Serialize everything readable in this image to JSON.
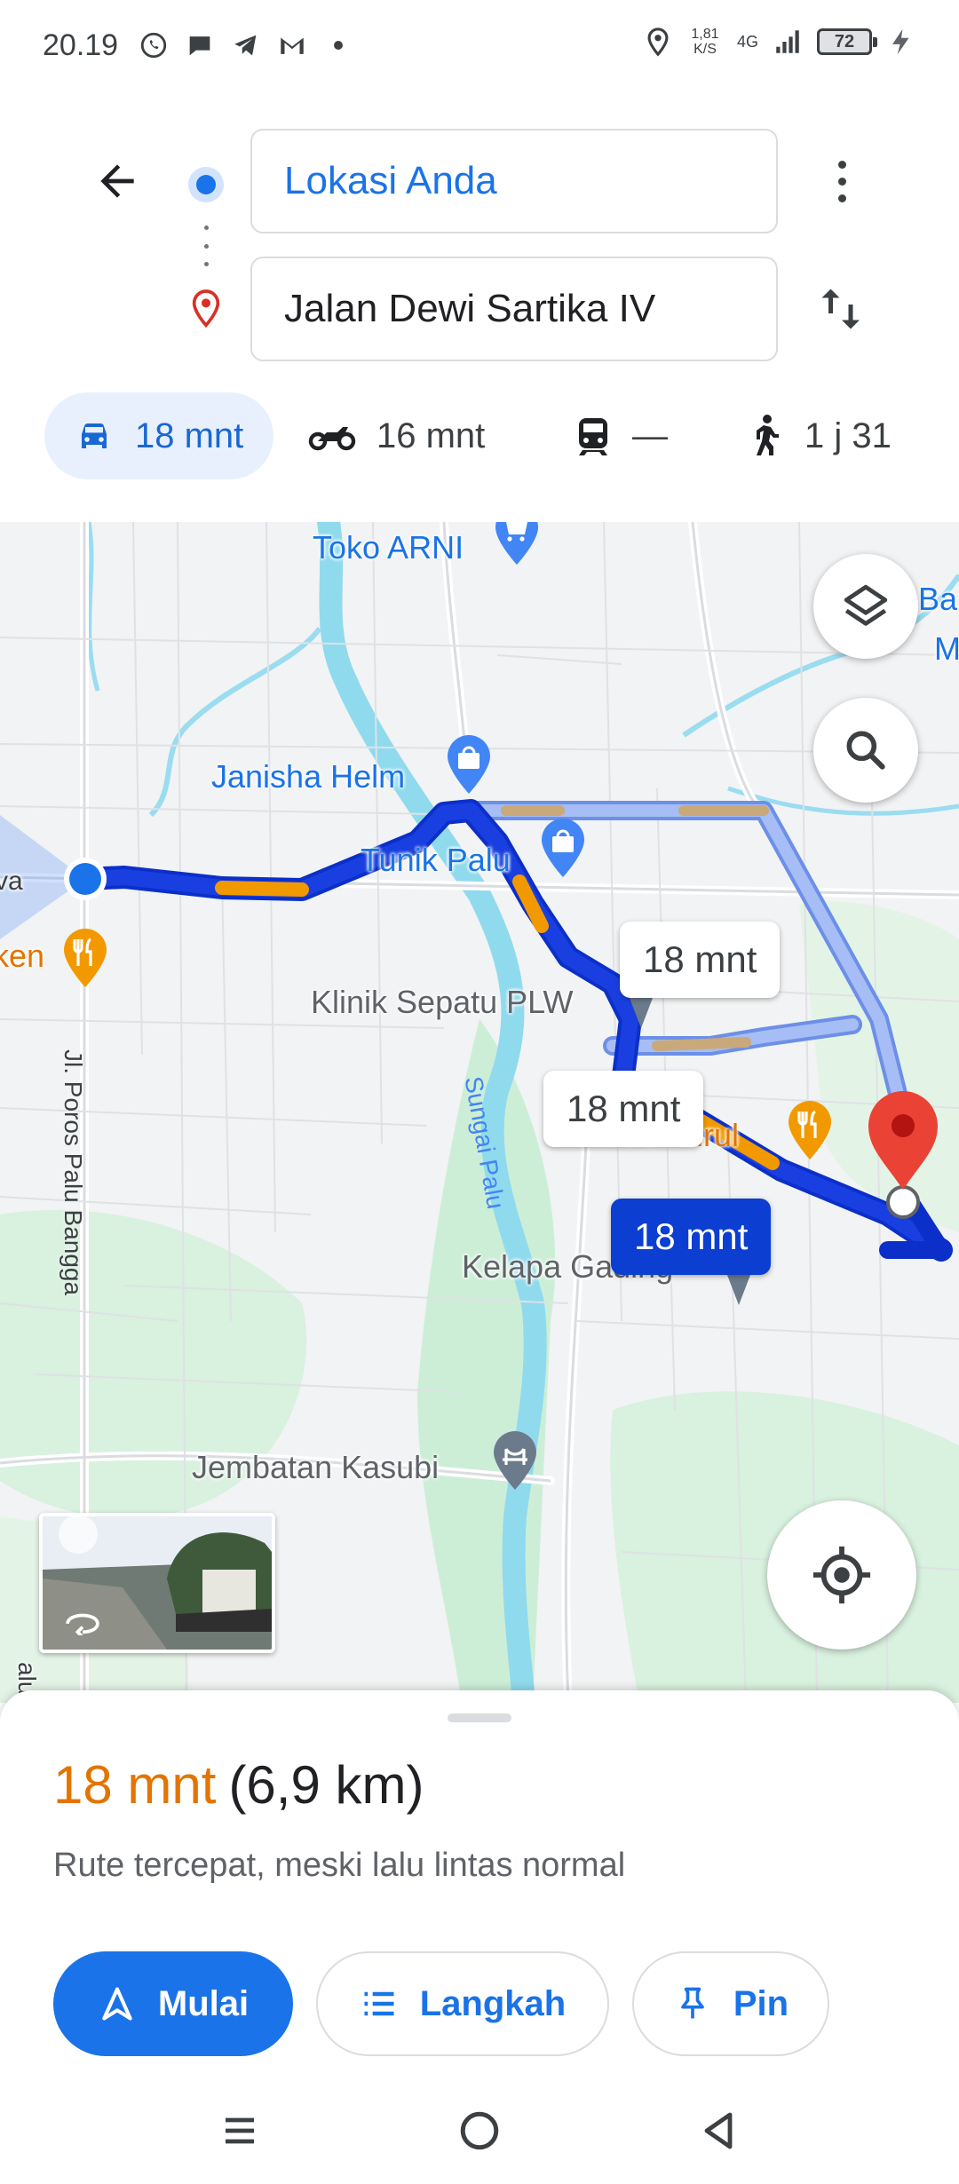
{
  "status_bar": {
    "time": "20.19",
    "net_speed_value": "1,81",
    "net_speed_unit": "K/S",
    "net_type": "4G",
    "battery": "72"
  },
  "search": {
    "origin": "Lokasi Anda",
    "destination": "Jalan Dewi Sartika IV"
  },
  "modes": [
    {
      "name": "car",
      "label": "18 mnt"
    },
    {
      "name": "motorcycle",
      "label": "16 mnt"
    },
    {
      "name": "transit",
      "label": "—"
    },
    {
      "name": "walk",
      "label": "1 j 31"
    }
  ],
  "map": {
    "labels": {
      "toko_arni": "Toko ARNI",
      "janisha_helm": "Janisha Helm",
      "tunik_palu": "Tunik Palu",
      "klinik": "Klinik Sepatu PLW",
      "mas_arirul": "Mas Arirul",
      "kelapa_gading": "Kelapa Gading",
      "jembatan": "Jembatan Kasubi",
      "sungai": "Sungai Palu",
      "road": "Jl. Poros Palu Bangga",
      "left_edge_1": "va",
      "left_edge_2": "ken",
      "right_edge_1": "Ba",
      "right_edge_2": "M",
      "bottom_edge": "alu"
    },
    "bubbles": {
      "alt1": "18 mnt",
      "alt2": "18 mnt",
      "primary": "18 mnt"
    },
    "colors": {
      "route_primary": "#1a3fe0",
      "route_alt": "#a6bdf5",
      "traffic": "#f29900",
      "destination_pin": "#ea4335"
    }
  },
  "sheet": {
    "time": "18 mnt",
    "distance": "(6,9 km)",
    "subtitle": "Rute tercepat, meski lalu lintas normal",
    "start_label": "Mulai",
    "steps_label": "Langkah",
    "pin_label": "Pin"
  }
}
